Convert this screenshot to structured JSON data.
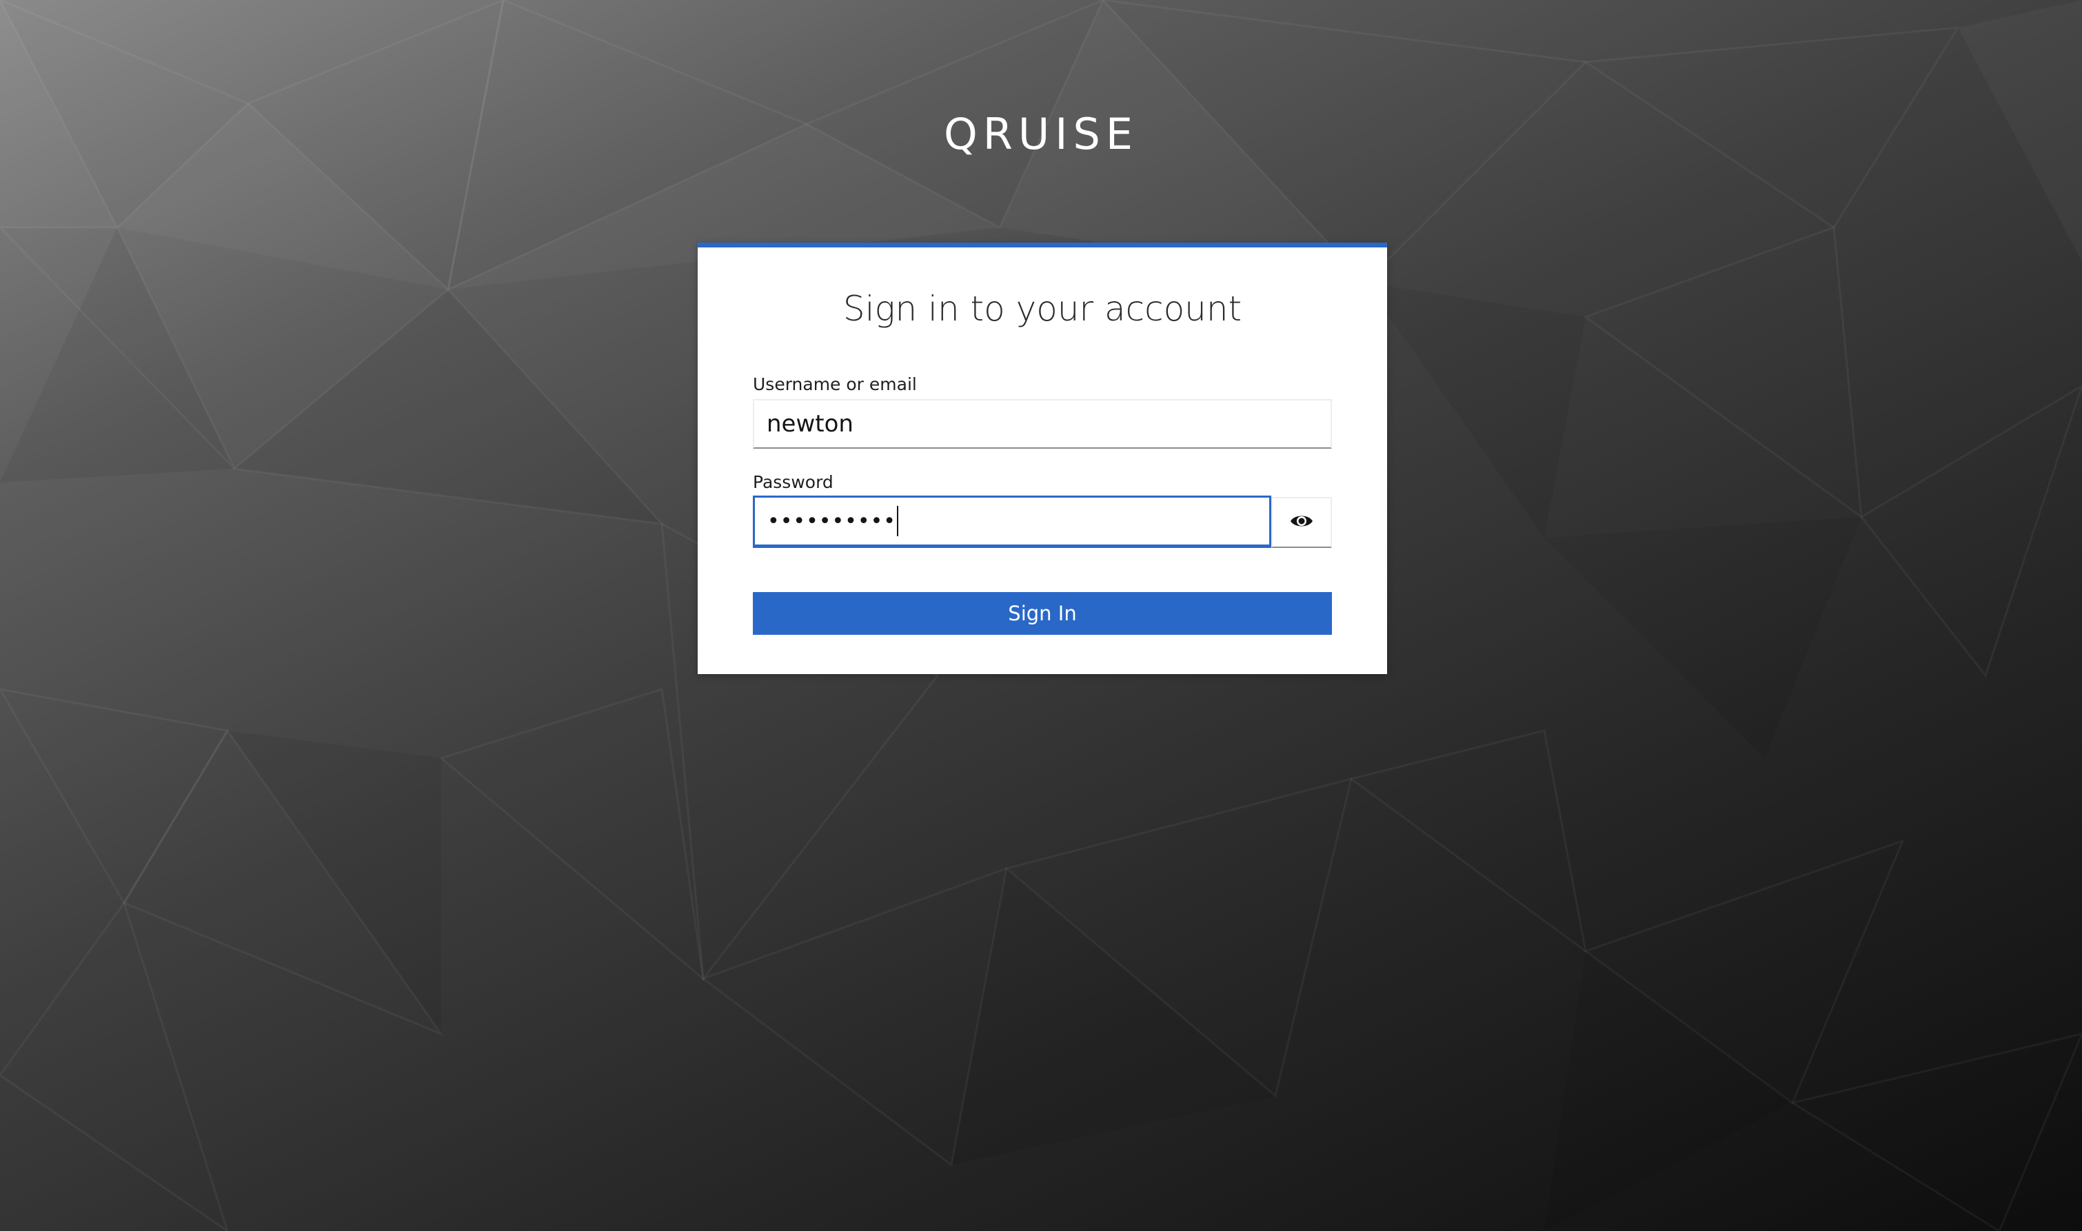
{
  "brand": {
    "name": "QRUISE"
  },
  "login": {
    "title": "Sign in to your account",
    "username_label": "Username or email",
    "username_value": "newton",
    "password_label": "Password",
    "password_masked": "••••••••••",
    "show_password_icon": "eye-icon",
    "submit_label": "Sign In"
  },
  "colors": {
    "accent": "#2a68c8",
    "card_background": "#ffffff",
    "page_background": "dark gray low-poly gradient"
  }
}
